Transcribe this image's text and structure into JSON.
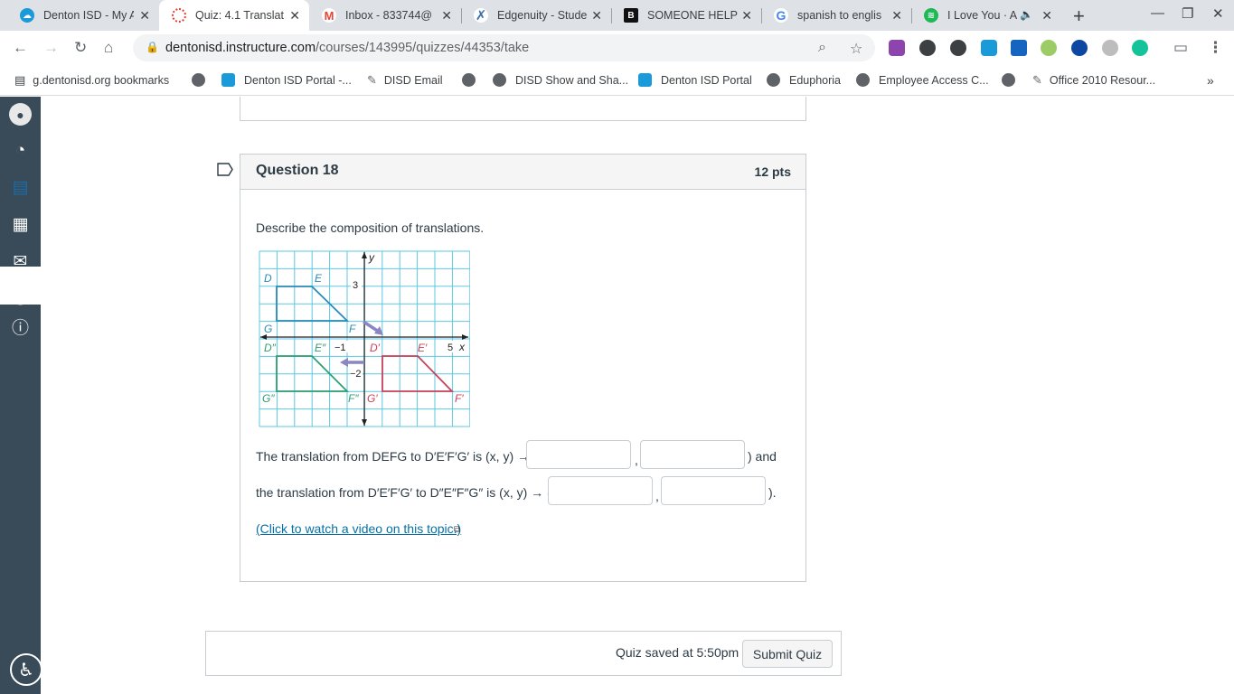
{
  "browser": {
    "tabs": [
      {
        "title": "Denton ISD - My A",
        "favicon_color": "#1a9ad9"
      },
      {
        "title": "Quiz: 4.1 Translat",
        "favicon_color": "#e13f2b"
      },
      {
        "title": "Inbox - 833744@",
        "favicon_color": "#ea4335"
      },
      {
        "title": "Edgenuity - Stude",
        "favicon_color": "#3a6fb0"
      },
      {
        "title": "SOMEONE HELP",
        "favicon_color": "#111111"
      },
      {
        "title": "spanish to englis",
        "favicon_color": "#4285f4"
      },
      {
        "title": "I Love You · A",
        "favicon_color": "#1db954"
      }
    ],
    "active_tab_index": 1,
    "url_domain": "dentonisd.instructure.com",
    "url_path": "/courses/143995/quizzes/44353/take",
    "bookmarks": [
      {
        "label": "g.dentonisd.org bookmarks"
      },
      {
        "label": "Denton ISD Portal -..."
      },
      {
        "label": "DISD Email"
      },
      {
        "label": ""
      },
      {
        "label": "DISD Show and Sha..."
      },
      {
        "label": "Denton ISD Portal"
      },
      {
        "label": "Eduphoria"
      },
      {
        "label": "Employee Access C..."
      },
      {
        "label": ""
      },
      {
        "label": "Office 2010 Resour..."
      }
    ]
  },
  "question": {
    "title": "Question 18",
    "points": "12 pts",
    "prompt": "Describe the composition of translations.",
    "line1_prefix": "The translation from DEFG to D′E′F′G′ is (x, y) → (",
    "line1_suffix": ") and",
    "line2_prefix": "the translation from D′E′F′G′ to D″E″F″G″ is (x, y) → (",
    "line2_suffix": ").",
    "comma": ",",
    "answers": [
      "",
      "",
      "",
      ""
    ],
    "video_link": "(Click to watch a video on this topic.)"
  },
  "figure": {
    "axis_x": "x",
    "axis_y": "y",
    "tick_3": "3",
    "tick_neg1": "−1",
    "tick_neg2": "−2",
    "tick_5": "5",
    "labels": {
      "D": "D",
      "E": "E",
      "G": "G",
      "F": "F",
      "D1": "D′",
      "E1": "E′",
      "F1": "F′",
      "G1": "G′",
      "D2": "D″",
      "E2": "E″",
      "F2": "F″",
      "G2": "G″"
    },
    "colors": {
      "grid": "#5bc8e0",
      "blue": "#2a8bb8",
      "red": "#c9415b",
      "green": "#2f9e72",
      "arrow": "#8b86c3"
    }
  },
  "footer": {
    "saved_text": "Quiz saved at 5:50pm",
    "submit_label": "Submit Quiz"
  }
}
